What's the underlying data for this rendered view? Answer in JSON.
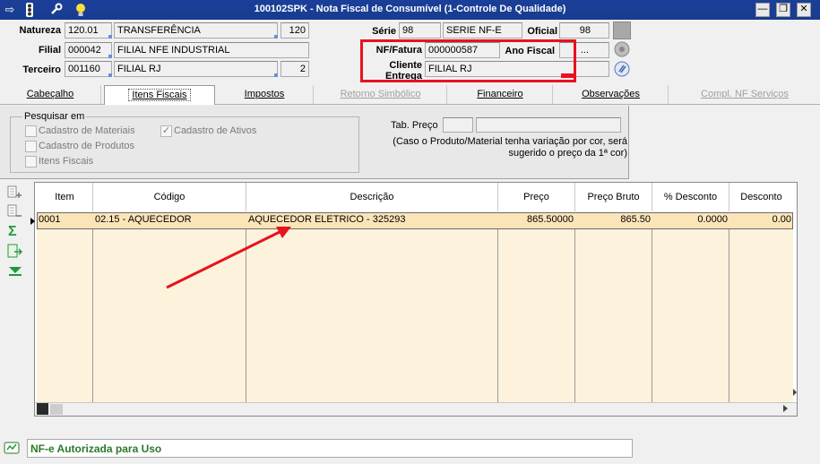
{
  "window": {
    "title": "100102SPK - Nota Fiscal de Consumível (1-Controle De Qualidade)",
    "minimize": "—",
    "restore": "❐",
    "close": "✕"
  },
  "header": {
    "natureza_label": "Natureza",
    "natureza_code": "120.01",
    "natureza_desc": "TRANSFERÊNCIA",
    "natureza_num": "120",
    "filial_label": "Filial",
    "filial_code": "000042",
    "filial_desc": "FILIAL NFE INDUSTRIAL",
    "terceiro_label": "Terceiro",
    "terceiro_code": "001160",
    "terceiro_desc": "FILIAL RJ",
    "terceiro_num": "2",
    "serie_label": "Série",
    "serie_code": "98",
    "serie_desc": "SERIE NF-E",
    "oficial_label": "Oficial",
    "oficial_value": "98",
    "nf_label": "NF/Fatura",
    "nf_value": "000000587",
    "ano_label": "Ano Fiscal",
    "ano_value": "...",
    "cliente_label_1": "Cliente",
    "cliente_label_2": "Entrega",
    "cliente_value": "FILIAL RJ"
  },
  "tabs": [
    {
      "label": "Cabeçalho",
      "state": "normal"
    },
    {
      "label": "Itens Fiscais",
      "state": "active"
    },
    {
      "label": "Impostos",
      "state": "normal"
    },
    {
      "label": "Retorno Simbólico",
      "state": "disabled"
    },
    {
      "label": "Financeiro",
      "state": "normal"
    },
    {
      "label": "Observações",
      "state": "normal"
    },
    {
      "label": "Compl. NF Serviços",
      "state": "disabled"
    }
  ],
  "search": {
    "group_title": "Pesquisar em",
    "options": [
      {
        "label": "Cadastro de Materiais",
        "checked": false
      },
      {
        "label": "Cadastro de Produtos",
        "checked": false
      },
      {
        "label": "Itens Fiscais",
        "checked": false
      },
      {
        "label": "Cadastro de Ativos",
        "checked": true
      }
    ],
    "tab_preco_label": "Tab. Preço",
    "tab_preco_note_1": "(Caso o Produto/Material tenha variação por cor, será",
    "tab_preco_note_2": "sugerido o preço da 1ª cor)"
  },
  "grid": {
    "columns": [
      "Item",
      "Código",
      "Descrição",
      "Preço",
      "Preço Bruto",
      "% Desconto",
      "Desconto"
    ],
    "rows": [
      {
        "item": "0001",
        "codigo": "02.15 - AQUECEDOR",
        "descricao": "AQUECEDOR ELETRICO - 325293",
        "preco": "865.50000",
        "preco_bruto": "865.50",
        "pct_desconto": "0.0000",
        "desconto": "0.00"
      }
    ]
  },
  "status": {
    "text": "NF-e Autorizada para Uso"
  },
  "colors": {
    "titlebar": "#1b3f99",
    "highlight_box": "#e8121e",
    "selected_row": "#fbe4b8",
    "status_text": "#2a7a2a"
  }
}
